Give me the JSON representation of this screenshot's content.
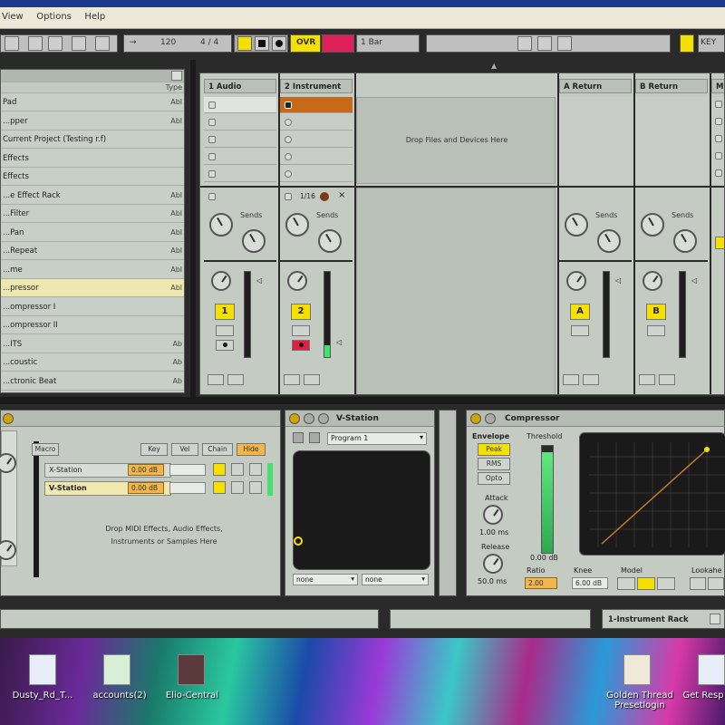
{
  "menubar": {
    "items": [
      "View",
      "Options",
      "Help"
    ]
  },
  "transport": {
    "tempo": "120",
    "signature": "4 / 4",
    "ovr": "OVR",
    "quantize": "1 Bar",
    "right_box": "KEY"
  },
  "browser": {
    "header": {
      "type_col": "Type"
    },
    "rows": [
      {
        "name": "Pad",
        "type": "Abl"
      },
      {
        "name": "...pper",
        "type": "Abl"
      },
      {
        "name": "Current Project (Testing r.f)",
        "type": ""
      },
      {
        "name": "Effects",
        "type": ""
      },
      {
        "name": "Effects",
        "type": ""
      },
      {
        "name": "...e Effect Rack",
        "type": "Abl"
      },
      {
        "name": "...Filter",
        "type": "Abl"
      },
      {
        "name": "...Pan",
        "type": "Abl"
      },
      {
        "name": "...Repeat",
        "type": "Abl"
      },
      {
        "name": "...me",
        "type": "Abl"
      },
      {
        "name": "...pressor",
        "type": "Abl"
      },
      {
        "name": "...ompressor I",
        "type": ""
      },
      {
        "name": "...ompressor II",
        "type": ""
      },
      {
        "name": "...ITS",
        "type": "Ab"
      },
      {
        "name": "...coustic",
        "type": "Ab"
      },
      {
        "name": "...ctronic Beat",
        "type": "Ab"
      }
    ],
    "selected_index": 10
  },
  "session": {
    "tracks": [
      {
        "name": "1 Audio",
        "button": "1"
      },
      {
        "name": "2 Instrument",
        "button": "2"
      },
      {
        "name": "A Return",
        "button": "A"
      },
      {
        "name": "B Return",
        "button": "B"
      },
      {
        "name": "M",
        "button": ""
      }
    ],
    "drop_text": "Drop Files and Devices Here",
    "sends_label": "Sends",
    "midi_value": "1/16"
  },
  "devices": {
    "rack": {
      "macro_label": "Macro",
      "buttons": [
        "Key",
        "Vel",
        "Chain",
        "Hide"
      ],
      "chains": [
        {
          "name": "X-Station",
          "db": "0.00 dB"
        },
        {
          "name": "V-Station",
          "db": "0.00 dB"
        }
      ],
      "drop_text": "Drop MIDI Effects, Audio Effects, Instruments or Samples Here"
    },
    "vstation": {
      "title": "V-Station",
      "preset": "Program 1",
      "sel1": "none",
      "sel2": "none"
    },
    "compressor": {
      "title": "Compressor",
      "envelope_label": "Envelope",
      "modes": [
        "Peak",
        "RMS",
        "Opto"
      ],
      "threshold_label": "Threshold",
      "attack_label": "Attack",
      "attack_value": "1.00 ms",
      "release_label": "Release",
      "release_value": "50.0 ms",
      "threshold_value": "0.00 dB",
      "ratio_label": "Ratio",
      "ratio_value": "2.00",
      "knee_label": "Knee",
      "knee_value": "6.00 dB",
      "model_label": "Model",
      "lookahead_label": "Lookahe"
    }
  },
  "statusbar": {
    "right_label": "1-Instrument Rack"
  },
  "desktop": {
    "icons": [
      {
        "label": "Dusty_Rd_T..."
      },
      {
        "label": "accounts(2)"
      },
      {
        "label": "Elio-Central"
      },
      {
        "label": "Golden Thread Presetlogin"
      },
      {
        "label": "Get Resp"
      }
    ]
  }
}
